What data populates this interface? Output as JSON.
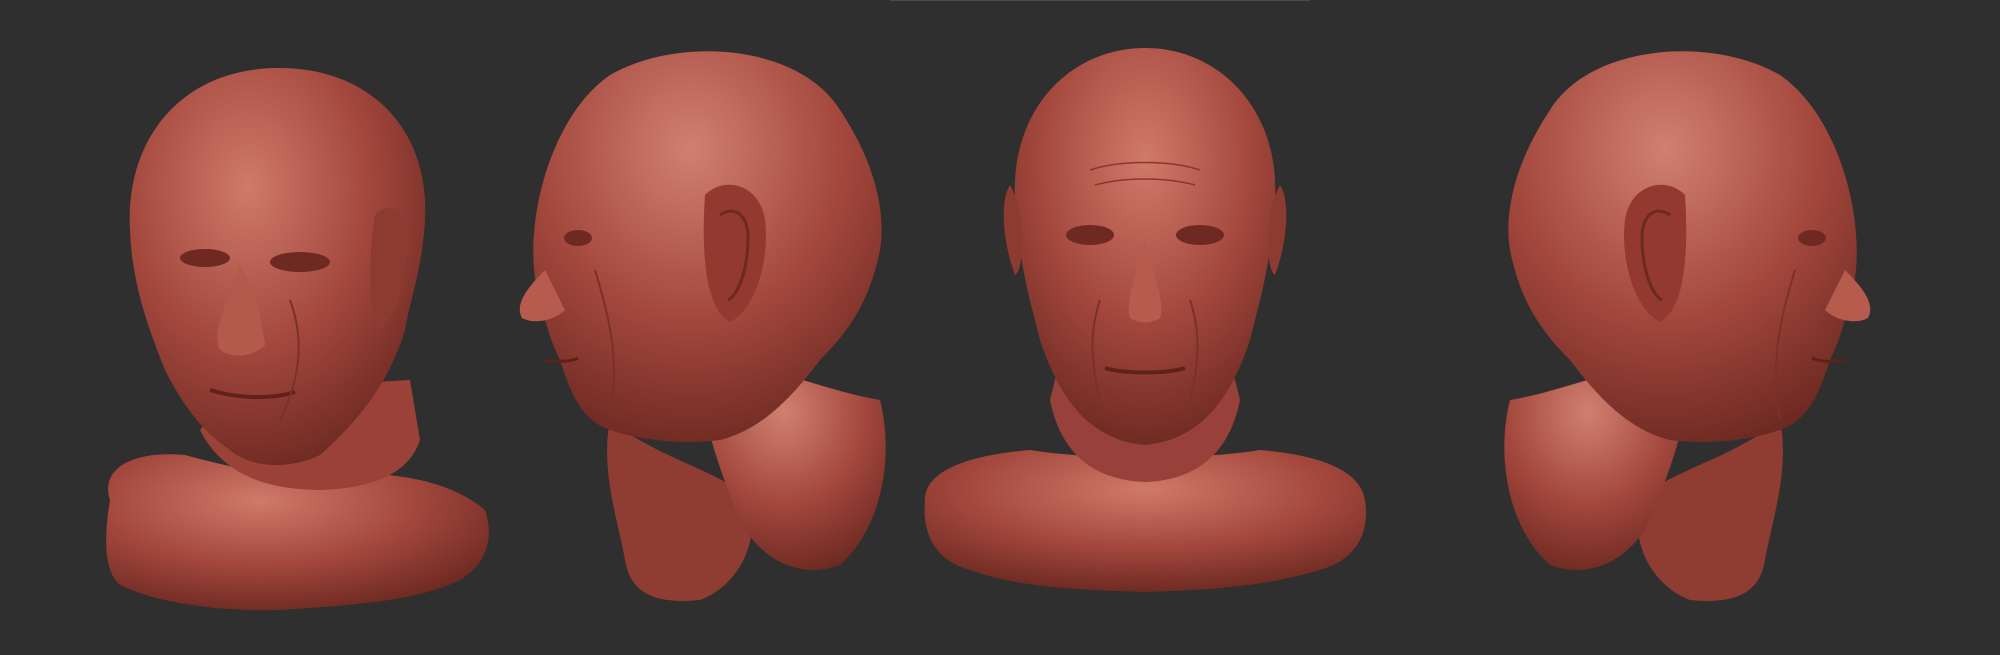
{
  "scene": {
    "background_color": "#2f2f2f",
    "clay_color": "#a44a40",
    "clay_highlight": "#d07a6a",
    "clay_shadow": "#6a2820",
    "views": [
      {
        "name": "three-quarter-left",
        "icon": "sculpted-head-bust"
      },
      {
        "name": "profile-left",
        "icon": "sculpted-head-bust"
      },
      {
        "name": "front",
        "icon": "sculpted-head-bust"
      },
      {
        "name": "profile-right",
        "icon": "sculpted-head-bust"
      }
    ]
  }
}
